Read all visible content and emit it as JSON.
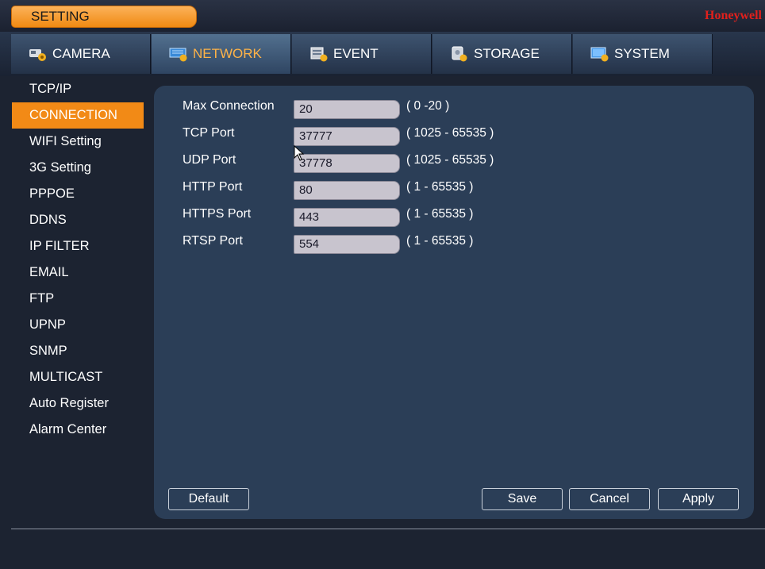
{
  "window": {
    "title": "SETTING",
    "brand": "Honeywell"
  },
  "tabs": [
    {
      "label": "CAMERA",
      "icon": "camera-settings-icon"
    },
    {
      "label": "NETWORK",
      "icon": "network-settings-icon"
    },
    {
      "label": "EVENT",
      "icon": "event-settings-icon"
    },
    {
      "label": "STORAGE",
      "icon": "storage-settings-icon"
    },
    {
      "label": "SYSTEM",
      "icon": "system-settings-icon"
    }
  ],
  "active_tab": "NETWORK",
  "sidebar": {
    "items": [
      {
        "label": "TCP/IP"
      },
      {
        "label": "CONNECTION"
      },
      {
        "label": "WIFI Setting"
      },
      {
        "label": "3G Setting"
      },
      {
        "label": "PPPOE"
      },
      {
        "label": "DDNS"
      },
      {
        "label": "IP FILTER"
      },
      {
        "label": "EMAIL"
      },
      {
        "label": "FTP"
      },
      {
        "label": "UPNP"
      },
      {
        "label": "SNMP"
      },
      {
        "label": "MULTICAST"
      },
      {
        "label": "Auto Register"
      },
      {
        "label": "Alarm Center"
      }
    ],
    "active": "CONNECTION"
  },
  "form": {
    "fields": [
      {
        "label": "Max Connection",
        "value": "20",
        "range": "( 0 -20 )"
      },
      {
        "label": "TCP Port",
        "value": "37777",
        "range": "( 1025 - 65535 )"
      },
      {
        "label": "UDP Port",
        "value": "37778",
        "range": "( 1025 - 65535 )"
      },
      {
        "label": "HTTP Port",
        "value": "80",
        "range": "( 1 - 65535 )"
      },
      {
        "label": "HTTPS Port",
        "value": "443",
        "range": "( 1 - 65535 )"
      },
      {
        "label": "RTSP Port",
        "value": "554",
        "range": "( 1 - 65535 )"
      }
    ]
  },
  "buttons": {
    "default": "Default",
    "save": "Save",
    "cancel": "Cancel",
    "apply": "Apply"
  },
  "colors": {
    "accent": "#f28a16",
    "brand": "#e0201c",
    "panel": "#2b3e57",
    "background": "#1c2331"
  }
}
